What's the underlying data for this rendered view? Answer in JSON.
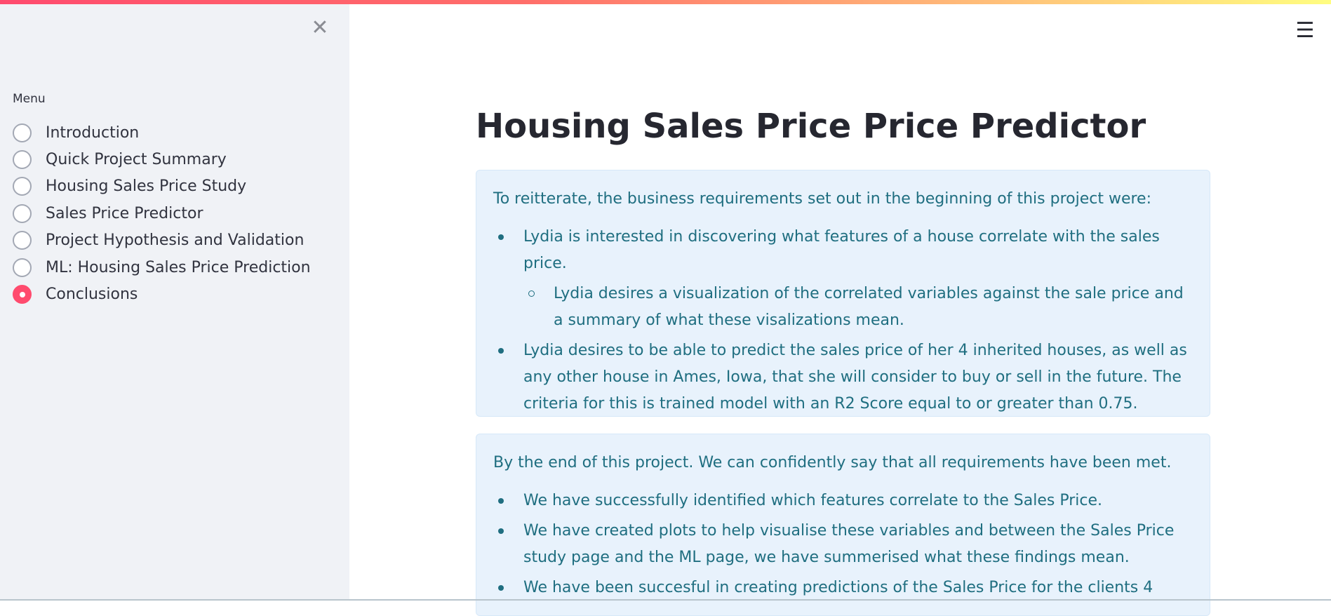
{
  "header": {
    "close_icon": "close-icon",
    "menu_icon": "hamburger-menu-icon",
    "accent_color": "#ff4b6e"
  },
  "sidebar": {
    "menu_label": "Menu",
    "items": [
      {
        "label": "Introduction",
        "selected": false
      },
      {
        "label": "Quick Project Summary",
        "selected": false
      },
      {
        "label": "Housing Sales Price Study",
        "selected": false
      },
      {
        "label": "Sales Price Predictor",
        "selected": false
      },
      {
        "label": "Project Hypothesis and Validation",
        "selected": false
      },
      {
        "label": "ML: Housing Sales Price Prediction",
        "selected": false
      },
      {
        "label": "Conclusions",
        "selected": true
      }
    ]
  },
  "main": {
    "title": "Housing Sales Price Price Predictor",
    "box1": {
      "intro": "To reitterate, the business requirements set out in the beginning of this project were:",
      "bullet1": "Lydia is interested in discovering what features of a house correlate with the sales price.",
      "sub_bullet1": "Lydia desires a visualization of the correlated variables against the sale price and a summary of what these visalizations mean.",
      "bullet2": "Lydia desires to be able to predict the sales price of her 4 inherited houses, as well as any other house in Ames, Iowa, that she will consider to buy or sell in the future. The criteria for this is trained model with an R2 Score equal to or greater than 0.75."
    },
    "box2": {
      "intro": "By the end of this project. We can confidently say that all requirements have been met.",
      "bullet1": "We have successfully identified which features correlate to the Sales Price.",
      "bullet2": "We have created plots to help visualise these variables and between the Sales Price study page and the ML page, we have summerised what these findings mean.",
      "bullet3": "We have been succesful in creating predictions of the Sales Price for the clients 4"
    }
  }
}
